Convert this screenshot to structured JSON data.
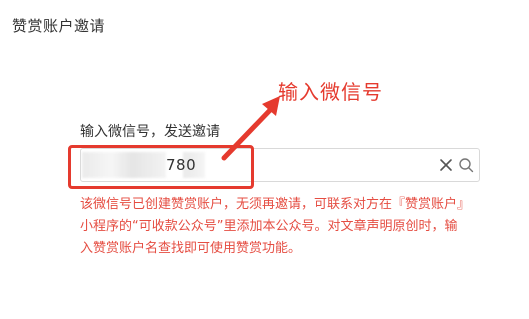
{
  "page": {
    "title": "赞赏账户邀请"
  },
  "form": {
    "label": "输入微信号，发送邀请",
    "input_value": "780",
    "error_message": "该微信号已创建赞赏账户，无须再邀请，可联系对方在『赞赏账户』小程序的“可收款公众号”里添加本公众号。对文章声明原创时，输入赞赏账户名查找即可使用赞赏功能。"
  },
  "annotation": {
    "label": "输入微信号",
    "color": "#e53a2e"
  },
  "icons": {
    "clear": "close-icon",
    "search": "search-icon"
  },
  "colors": {
    "error": "#e54d42",
    "annotation": "#e53a2e",
    "border": "#d9d9d9"
  }
}
